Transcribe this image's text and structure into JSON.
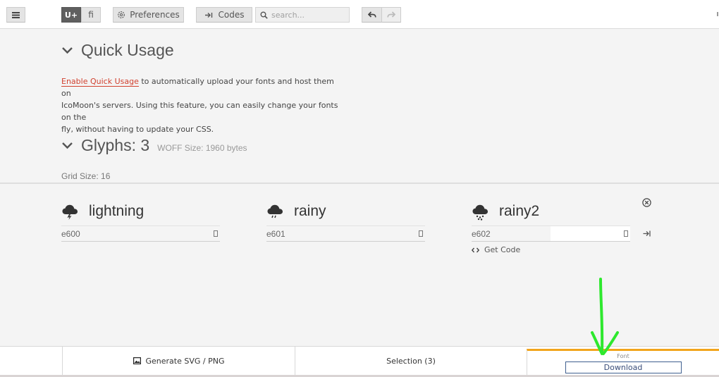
{
  "toolbar": {
    "unicode_label": "U+",
    "ligature_label": "ﬁ",
    "preferences_label": "Preferences",
    "codes_label": "Codes",
    "search_placeholder": "search..."
  },
  "quick_usage": {
    "title": "Quick Usage",
    "link_text": "Enable Quick Usage",
    "body_line1": " to automatically upload your fonts and host them on",
    "body_line2": "IcoMoon's servers. Using this feature, you can easily change your fonts on the",
    "body_line3": "fly, without having to update your CSS."
  },
  "glyphs_section": {
    "title": "Glyphs: 3",
    "woff_size": "WOFF Size: 1960 bytes",
    "grid_size": "Grid Size: 16"
  },
  "glyphs": [
    {
      "name": "lightning",
      "code": "e600"
    },
    {
      "name": "rainy",
      "code": "e601"
    },
    {
      "name": "rainy2",
      "code": "e602"
    }
  ],
  "get_code_label": "Get Code",
  "bottom_bar": {
    "generate_label": "Generate SVG / PNG",
    "selection_label": "Selection (3)",
    "font_label": "Font",
    "download_label": "Download"
  },
  "colors": {
    "accent_tab": "#f2a51c",
    "link": "#d1412f",
    "annotation_arrow": "#2ee82e"
  }
}
